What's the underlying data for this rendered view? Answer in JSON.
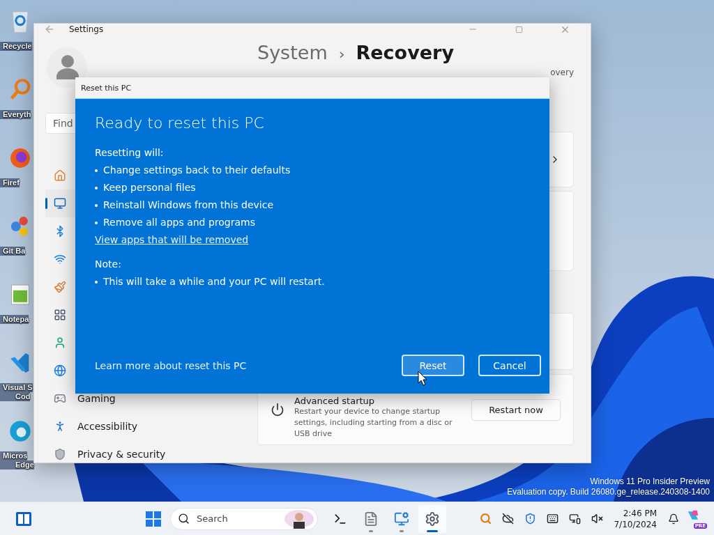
{
  "desktop_icons": [
    {
      "kind": "recycle-bin",
      "lines": [
        "Recycle"
      ]
    },
    {
      "kind": "magnifier",
      "lines": [
        "Everyth"
      ]
    },
    {
      "kind": "browser",
      "lines": [
        "Firef"
      ]
    },
    {
      "kind": "git",
      "lines": [
        "Git Ba"
      ]
    },
    {
      "kind": "notepad",
      "lines": [
        "Notepa"
      ]
    },
    {
      "kind": "code-editor",
      "lines": [
        "Visual S",
        "Cod"
      ]
    },
    {
      "kind": "edge",
      "lines": [
        "Micros",
        "Edge"
      ]
    }
  ],
  "settings": {
    "title": "Settings",
    "search": {
      "placeholder": "Find"
    },
    "nav": [
      {
        "kind": "home",
        "selected": false
      },
      {
        "kind": "system",
        "selected": true
      },
      {
        "kind": "bluetooth",
        "selected": false
      },
      {
        "kind": "network",
        "selected": false
      },
      {
        "kind": "personalization",
        "selected": false
      },
      {
        "kind": "apps",
        "selected": false
      },
      {
        "kind": "accounts",
        "selected": false
      },
      {
        "kind": "time",
        "selected": false
      },
      {
        "kind": "gaming",
        "label": "Gaming",
        "selected": false
      },
      {
        "kind": "accessibility",
        "label": "Accessibility",
        "selected": false
      },
      {
        "kind": "privacy",
        "label": "Privacy & security",
        "selected": false
      }
    ],
    "breadcrumb": {
      "parent": "System",
      "separator": "›",
      "current": "Recovery"
    },
    "fragment": "overy",
    "cards": [
      {
        "kind": "link"
      },
      {
        "kind": "blank"
      },
      {
        "kind": "blank"
      },
      {
        "kind": "action",
        "title": "Advanced startup",
        "description": "Restart your device to change startup settings, including starting from a disc or USB drive",
        "button": "Restart now"
      }
    ]
  },
  "dialog": {
    "title": "Reset this PC",
    "heading": "Ready to reset this PC",
    "intro": "Resetting will:",
    "bullets": [
      "Change settings back to their defaults",
      "Keep personal files",
      "Reinstall Windows from this device",
      "Remove all apps and programs"
    ],
    "link": "View apps that will be removed",
    "note_label": "Note:",
    "note_bullets": [
      "This will take a while and your PC will restart."
    ],
    "learn_more": "Learn more about reset this PC",
    "buttons": [
      {
        "label": "Reset",
        "hovered": true
      },
      {
        "label": "Cancel",
        "hovered": false
      }
    ]
  },
  "watermark": [
    "Windows 11 Pro Insider Preview",
    "Evaluation copy. Build 26080.ge_release.240308-1400"
  ],
  "taskbar": {
    "search": {
      "placeholder": "Search"
    },
    "apps": [
      {
        "kind": "terminal",
        "running": false,
        "active": false
      },
      {
        "kind": "file",
        "running": true,
        "active": false
      },
      {
        "kind": "remote",
        "running": true,
        "active": false
      },
      {
        "kind": "settings",
        "running": true,
        "active": true
      }
    ],
    "tray": [
      {
        "kind": "magnifier"
      },
      {
        "kind": "cloud-off"
      },
      {
        "kind": "shield"
      },
      {
        "kind": "keyboard"
      },
      {
        "kind": "display"
      },
      {
        "kind": "volume-off"
      }
    ],
    "time": "2:46 PM",
    "date": "7/10/2024",
    "copilot_badge": "PRE"
  }
}
